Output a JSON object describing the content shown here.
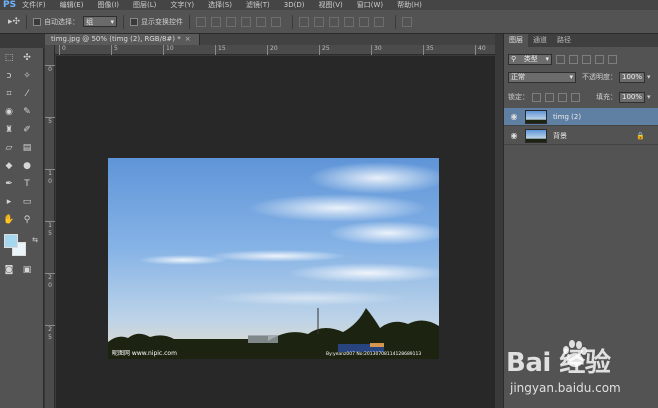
{
  "app": {
    "logo": "PS",
    "menus": [
      "文件(F)",
      "编辑(E)",
      "图像(I)",
      "图层(L)",
      "文字(Y)",
      "选择(S)",
      "滤镜(T)",
      "3D(D)",
      "视图(V)",
      "窗口(W)",
      "帮助(H)"
    ]
  },
  "options_bar": {
    "auto_select_label": "自动选择：",
    "auto_select_value": "组",
    "show_transform_label": "显示变换控件"
  },
  "document": {
    "tab_title": "timg.jpg @ 50% (timg (2), RGB/8#) *",
    "close_glyph": "×"
  },
  "ruler": {
    "top_ticks": [
      "0",
      "5",
      "10",
      "15",
      "20",
      "25",
      "30",
      "35",
      "40"
    ],
    "left_ticks": [
      "0",
      "5",
      "1\n0",
      "1\n5",
      "2\n0",
      "2\n5"
    ]
  },
  "photo": {
    "watermark_left": "昵图网 www.nipic.com",
    "watermark_right": "By:yeanz007 No:20130708114128689113"
  },
  "panel": {
    "tabs": [
      "图层",
      "通道",
      "路径"
    ],
    "filter_kind": "类型",
    "blend_mode": "正常",
    "opacity_label": "不透明度：",
    "opacity_value": "100%",
    "lock_label": "锁定：",
    "fill_label": "填充：",
    "fill_value": "100%",
    "layers": [
      {
        "name": "timg (2)",
        "selected": true
      },
      {
        "name": "背景",
        "selected": false,
        "locked": true
      }
    ]
  },
  "site_watermark": {
    "brand": "Bai 经验",
    "url": "jingyan.baidu.com"
  }
}
